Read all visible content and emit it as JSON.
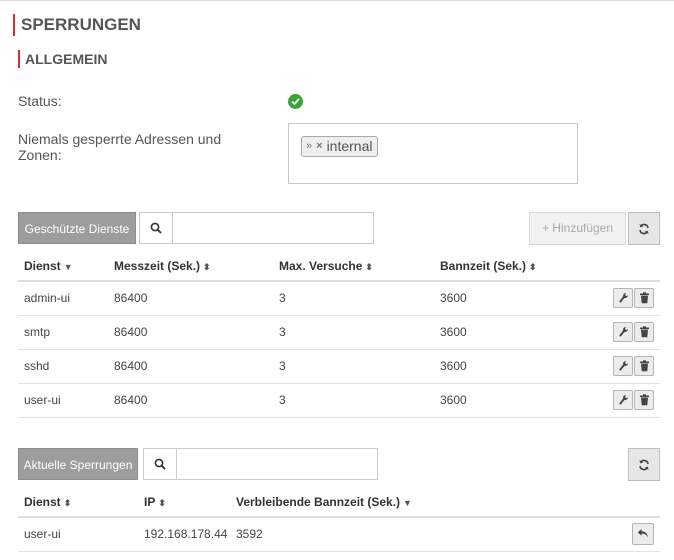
{
  "page": {
    "title": "SPERRUNGEN",
    "section": "ALLGEMEIN"
  },
  "general": {
    "status_label": "Status:",
    "status_icon": "check-circle-icon",
    "status_color": "#3aa33a",
    "zones_label": "Niemals gesperrte Adressen und Zonen:",
    "zones": [
      {
        "label": "internal",
        "icon": "zone-chevrons-icon"
      }
    ]
  },
  "services": {
    "tab_label": "Geschützte Dienste",
    "search_placeholder": "",
    "search_value": "",
    "add_label": "+ Hinzufügen",
    "columns": [
      "Dienst",
      "Messzeit (Sek.)",
      "Max. Versuche",
      "Bannzeit (Sek.)"
    ],
    "rows": [
      {
        "dienst": "admin-ui",
        "messzeit": "86400",
        "versuche": "3",
        "bannzeit": "3600"
      },
      {
        "dienst": "smtp",
        "messzeit": "86400",
        "versuche": "3",
        "bannzeit": "3600"
      },
      {
        "dienst": "sshd",
        "messzeit": "86400",
        "versuche": "3",
        "bannzeit": "3600"
      },
      {
        "dienst": "user-ui",
        "messzeit": "86400",
        "versuche": "3",
        "bannzeit": "3600"
      }
    ]
  },
  "bans": {
    "tab_label": "Aktuelle Sperrungen",
    "search_placeholder": "",
    "search_value": "",
    "columns": [
      "Dienst",
      "IP",
      "Verbleibende Bannzeit (Sek.)"
    ],
    "rows": [
      {
        "dienst": "user-ui",
        "ip": "192.168.178.44",
        "remaining": "3592"
      }
    ]
  },
  "colors": {
    "accent": "#d22d3b",
    "tab_bg": "#9d9d9d"
  }
}
